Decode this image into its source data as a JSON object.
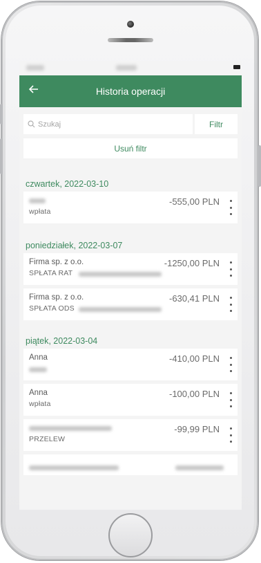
{
  "header": {
    "title": "Historia operacji",
    "back_icon": "arrow-left-icon"
  },
  "search": {
    "placeholder": "Szukaj",
    "filter_label": "Filtr"
  },
  "clear_filter_label": "Usuń filtr",
  "groups": [
    {
      "date": "czwartek, 2022-03-10",
      "items": [
        {
          "name": "",
          "desc": "wpłata",
          "amount": "-555,00 PLN"
        }
      ]
    },
    {
      "date": "poniedziałek, 2022-03-07",
      "items": [
        {
          "name": "Firma sp. z o.o.",
          "desc": "SPŁATA RAT",
          "amount": "-1250,00 PLN"
        },
        {
          "name": "Firma sp. z o.o.",
          "desc": "SPŁATA ODS",
          "amount": "-630,41 PLN"
        }
      ]
    },
    {
      "date": "piątek, 2022-03-04",
      "items": [
        {
          "name": "Anna",
          "desc": "",
          "amount": "-410,00 PLN"
        },
        {
          "name": "Anna",
          "desc": "wpłata",
          "amount": "-100,00 PLN"
        },
        {
          "name": "",
          "desc": "PRZELEW",
          "amount": "-99,99 PLN"
        }
      ]
    }
  ],
  "colors": {
    "brand_green": "#3e8a5f",
    "background": "#f4f4f4"
  }
}
